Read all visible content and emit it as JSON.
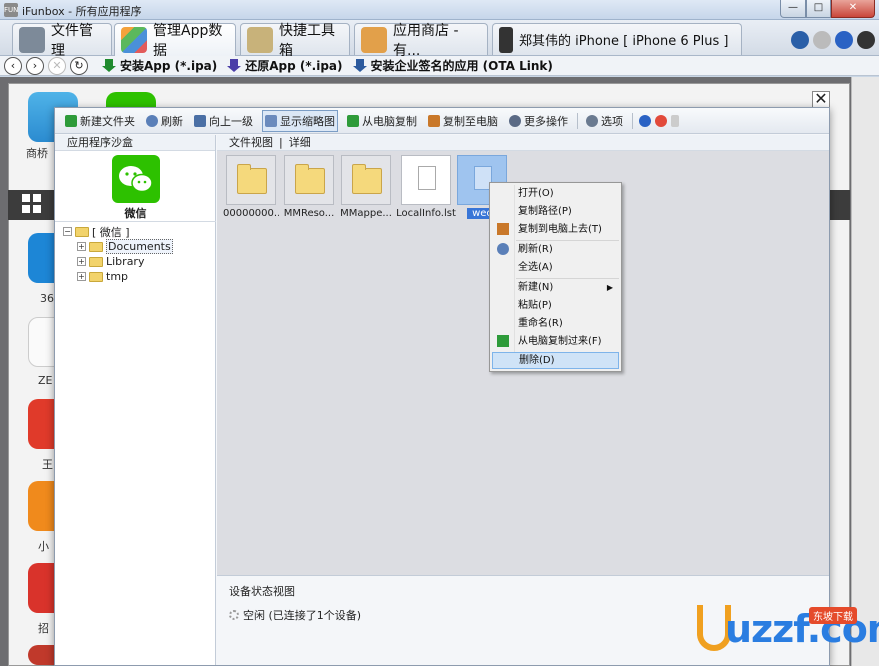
{
  "window": {
    "title": "iFunbox - 所有应用程序"
  },
  "tabs": [
    {
      "label": "文件管理"
    },
    {
      "label": "管理App数据"
    },
    {
      "label": "快捷工具箱"
    },
    {
      "label": "应用商店 - 有..."
    },
    {
      "label": "郑其伟的 iPhone [ iPhone 6 Plus ]"
    }
  ],
  "toolbar": {
    "install_app": "安装App (*.ipa)",
    "restore_app": "还原App (*.ipa)",
    "install_enterprise": "安装企业签名的应用  (OTA Link)"
  },
  "background": {
    "app_labels": [
      "商桥",
      "36",
      "ZE",
      "王",
      "小",
      "招"
    ]
  },
  "dialog_toolbar": {
    "new_folder": "新建文件夹",
    "refresh": "刷新",
    "up": "向上一级",
    "thumbnails": "显示缩略图",
    "copy_from_pc": "从电脑复制",
    "copy_to_pc": "复制至电脑",
    "more": "更多操作",
    "options": "选项"
  },
  "left_pane": {
    "header": "应用程序沙盒",
    "app_name": "微信",
    "tree": [
      {
        "label": "[ 微信 ]",
        "level": 0,
        "expander": "−"
      },
      {
        "label": "Documents",
        "level": 1,
        "expander": "+"
      },
      {
        "label": "Library",
        "level": 1,
        "expander": "+"
      },
      {
        "label": "tmp",
        "level": 1,
        "expander": "+"
      }
    ]
  },
  "right_pane": {
    "view_label": "文件视图",
    "detail_label": "详细",
    "files": [
      {
        "name": "00000000...",
        "type": "folder"
      },
      {
        "name": "MMReso...",
        "type": "folder"
      },
      {
        "name": "MMappe...",
        "type": "folder"
      },
      {
        "name": "LocalInfo.lst",
        "type": "file"
      },
      {
        "name": "wec",
        "type": "file"
      }
    ]
  },
  "status_pane": {
    "header": "设备状态视图",
    "status": "空闲 (已连接了1个设备)"
  },
  "context_menu": {
    "open": "打开(O)",
    "copy_path": "复制路径(P)",
    "copy_to_pc": "复制到电脑上去(T)",
    "refresh": "刷新(R)",
    "select_all": "全选(A)",
    "new": "新建(N)",
    "paste": "粘贴(P)",
    "rename": "重命名(R)",
    "copy_from_pc": "从电脑复制过来(F)",
    "delete": "删除(D)"
  },
  "watermark": {
    "text": "uzzf.com",
    "badge": "东坡下载"
  },
  "colors": {
    "wechat_green": "#2dc100",
    "selection_blue": "#3875d7",
    "menu_highlight": "#cfe3f7"
  }
}
